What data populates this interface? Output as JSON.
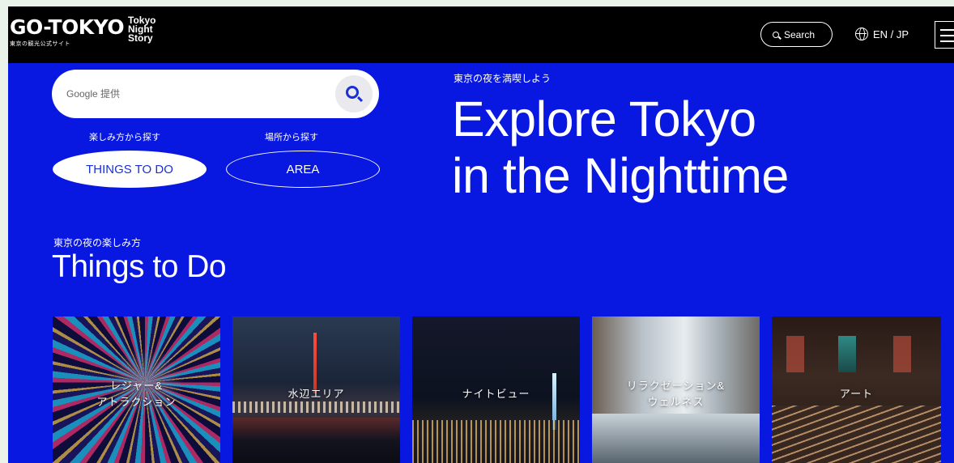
{
  "header": {
    "logo_main": "GO-TOKYO",
    "logo_sub": "東京の観光公式サイト",
    "logo_side": [
      "Tokyo",
      "Night",
      "Story"
    ],
    "search_label": "Search",
    "lang_label": "EN / JP",
    "icons": {
      "search": "search-icon",
      "globe": "globe-icon",
      "menu": "hamburger-menu-icon"
    }
  },
  "search": {
    "placeholder": "Google 提供",
    "button_icon": "search-icon"
  },
  "filters": {
    "things_label": "楽しみ方から探す",
    "area_label": "場所から探す",
    "things_button": "THINGS TO DO",
    "area_button": "AREA"
  },
  "hero": {
    "subtitle": "東京の夜を満喫しよう",
    "title_line1": "Explore Tokyo",
    "title_line2": "in the Nighttime"
  },
  "section": {
    "subtitle": "東京の夜の楽しみ方",
    "title": "Things to Do"
  },
  "cards": [
    {
      "line1": "レジャー&",
      "line2": "アトラクション"
    },
    {
      "line1": "水辺エリア",
      "line2": ""
    },
    {
      "line1": "ナイトビュー",
      "line2": ""
    },
    {
      "line1": "リラクゼーション&",
      "line2": "ウェルネス"
    },
    {
      "line1": "アート",
      "line2": ""
    }
  ],
  "colors": {
    "background": "#0918e0",
    "header": "#000000",
    "accent": "#1a2fd4"
  }
}
